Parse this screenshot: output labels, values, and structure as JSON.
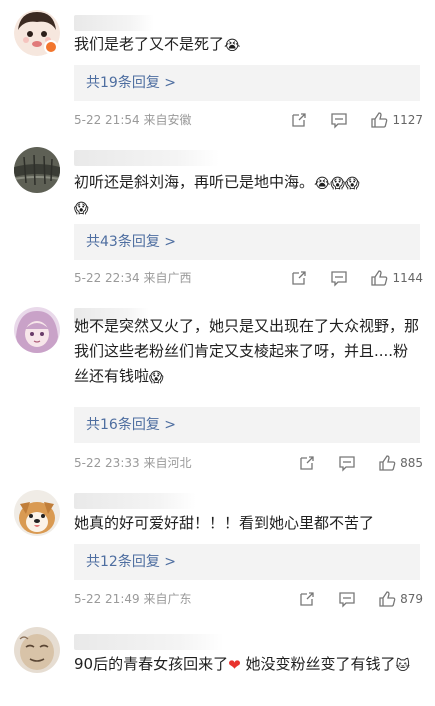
{
  "comments": [
    {
      "text": "我们是老了又不是死了",
      "emojis": [
        "😭"
      ],
      "reply_label": "共19条回复 >",
      "time": "5-22 21:54",
      "location": "来自安徽",
      "likes": "1127"
    },
    {
      "text": "初听还是斜刘海，再听已是地中海。",
      "emojis": [
        "😭",
        "😱",
        "😱",
        "😱"
      ],
      "reply_label": "共43条回复 >",
      "time": "5-22 22:34",
      "location": "来自广西",
      "likes": "1144"
    },
    {
      "text": "她不是突然又火了，她只是又出现在了大众视野，那我们这些老粉丝们肯定又支棱起来了呀，并且....粉丝还有钱啦",
      "emojis": [
        "😱"
      ],
      "reply_label": "共16条回复 >",
      "time": "5-22 23:33",
      "location": "来自河北",
      "likes": "885"
    },
    {
      "text": "她真的好可爱好甜！！！看到她心里都不苦了",
      "emojis": [],
      "reply_label": "共12条回复 >",
      "time": "5-22 21:49",
      "location": "来自广东",
      "likes": "879"
    },
    {
      "text_a": "90后的青春女孩回来了",
      "heart": "❤",
      "text_b": " 她没变粉丝变了有钱了",
      "emojis": [
        "🐱"
      ]
    }
  ],
  "icons": {
    "share": "share-icon",
    "comment": "comment-icon",
    "like": "thumbs-up-icon"
  },
  "colors": {
    "reply_link": "#4e6ea0",
    "meta_text": "#9a9a9a",
    "heart": "#e8322d"
  }
}
